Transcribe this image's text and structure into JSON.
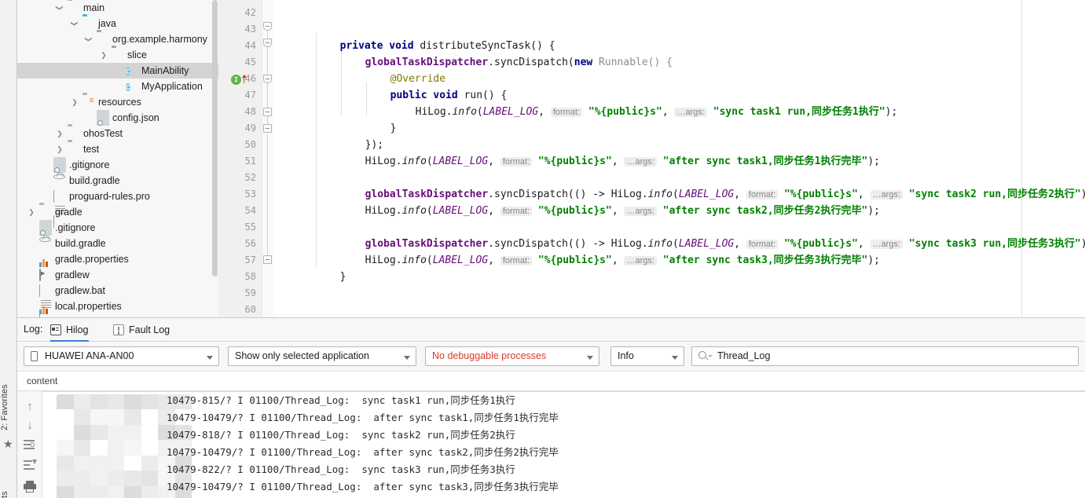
{
  "left_rail": {
    "favorites_tab": "2: Favorites",
    "star_icon": "star-icon",
    "cut_tab": "ts"
  },
  "project_tree": {
    "items": [
      {
        "label": "main",
        "indent": 64,
        "chevron": "v",
        "icon": "folder-gray"
      },
      {
        "label": "java",
        "indent": 83,
        "chevron": "v",
        "icon": "folder-blue"
      },
      {
        "label": "org.example.harmony",
        "indent": 101,
        "chevron": "v",
        "icon": "package"
      },
      {
        "label": "slice",
        "indent": 120,
        "chevron": ">",
        "icon": "package"
      },
      {
        "label": "MainAbility",
        "indent": 138,
        "chevron": "",
        "icon": "class",
        "selected": true
      },
      {
        "label": "MyApplication",
        "indent": 138,
        "chevron": "",
        "icon": "class"
      },
      {
        "label": "resources",
        "indent": 83,
        "chevron": ">",
        "icon": "resources"
      },
      {
        "label": "config.json",
        "indent": 101,
        "chevron": "",
        "icon": "json"
      },
      {
        "label": "ohosTest",
        "indent": 64,
        "chevron": ">",
        "icon": "folder-gray"
      },
      {
        "label": "test",
        "indent": 64,
        "chevron": ">",
        "icon": "folder-gray"
      },
      {
        "label": ".gitignore",
        "indent": 46,
        "chevron": "",
        "icon": "json"
      },
      {
        "label": "build.gradle",
        "indent": 46,
        "chevron": "",
        "icon": "gradle"
      },
      {
        "label": "proguard-rules.pro",
        "indent": 46,
        "chevron": "",
        "icon": "file"
      },
      {
        "label": "gradle",
        "indent": 28,
        "chevron": ">",
        "icon": "folder-gray"
      },
      {
        "label": ".gitignore",
        "indent": 28,
        "chevron": "",
        "icon": "json"
      },
      {
        "label": "build.gradle",
        "indent": 28,
        "chevron": "",
        "icon": "gradle"
      },
      {
        "label": "gradle.properties",
        "indent": 28,
        "chevron": "",
        "icon": "props"
      },
      {
        "label": "gradlew",
        "indent": 28,
        "chevron": "",
        "icon": "exe"
      },
      {
        "label": "gradlew.bat",
        "indent": 28,
        "chevron": "",
        "icon": "file"
      },
      {
        "label": "local.properties",
        "indent": 28,
        "chevron": "",
        "icon": "props"
      }
    ]
  },
  "editor": {
    "line_numbers": [
      42,
      43,
      44,
      45,
      46,
      47,
      48,
      49,
      50,
      51,
      52,
      53,
      54,
      55,
      56,
      57,
      58,
      59,
      60
    ],
    "run_marker_line": 46,
    "run_marker_glyph": "I",
    "hints": {
      "format": "format:",
      "args": "…args:"
    },
    "code": {
      "l43_private": "private",
      "l43_void": "void",
      "l43_name": "distributeSyncTask() {",
      "l44_field": "globalTaskDispatcher",
      "l44_call": ".syncDispatch(",
      "l44_new": "new",
      "l44_anon": " Runnable() {",
      "l45_override": "@Override",
      "l46_public": "public",
      "l46_void": "void",
      "l46_run": "run() {",
      "l47_obj": "HiLog.",
      "l47_mtd": "info",
      "l47_p1": "(",
      "l47_label": "LABEL_LOG",
      "l47_comma": ", ",
      "l47_fmt": "\"%{public}s\"",
      "l47_comma2": ", ",
      "l47_arg": "\"sync task1 run,同步任务1执行\"",
      "l47_end": ");",
      "l48_brace": "}",
      "l49_brace": "});",
      "l50_arg": "\"after sync task1,同步任务1执行完毕\"",
      "l50_end": ");",
      "l52_lambda": ".syncDispatch(() -> HiLog.",
      "l52_arg": "\"sync task2 run,同步任务2执行\"",
      "l52_end": "));",
      "l53_arg": "\"after sync task2,同步任务2执行完毕\"",
      "l53_end": ");",
      "l55_arg": "\"sync task3 run,同步任务3执行\"",
      "l55_end": "));",
      "l56_arg": "\"after sync task3,同步任务3执行完毕\"",
      "l56_end": ");",
      "l57_brace": "}",
      "l60_brace": "}"
    }
  },
  "log_panel": {
    "log_label": "Log:",
    "tabs": [
      {
        "label": "Hilog",
        "icon": "hilog-icon",
        "active": true
      },
      {
        "label": "Fault Log",
        "icon": "faultlog-icon",
        "active": false
      }
    ],
    "filters": {
      "device": "HUAWEI ANA-AN00",
      "scope": "Show only selected application",
      "process": "No debuggable processes",
      "level": "Info",
      "search_value": "Thread_Log"
    },
    "column_header": "content",
    "side_icons": [
      "scroll-up-icon",
      "scroll-down-icon",
      "soft-wrap-icon",
      "scroll-to-end-icon",
      "print-icon"
    ],
    "lines": [
      "10479-815/? I 01100/Thread_Log:  sync task1 run,同步任务1执行",
      "10479-10479/? I 01100/Thread_Log:  after sync task1,同步任务1执行完毕",
      "10479-818/? I 01100/Thread_Log:  sync task2 run,同步任务2执行",
      "10479-10479/? I 01100/Thread_Log:  after sync task2,同步任务2执行完毕",
      "10479-822/? I 01100/Thread_Log:  sync task3 run,同步任务3执行",
      "10479-10479/? I 01100/Thread_Log:  after sync task3,同步任务3执行完毕"
    ]
  },
  "colors": {
    "accent": "#3d7eda",
    "string": "#008000",
    "keyword": "#000080",
    "field": "#660e7a",
    "error": "#d63c2f",
    "run_green": "#62b543",
    "selection": "#d4d4d4"
  }
}
